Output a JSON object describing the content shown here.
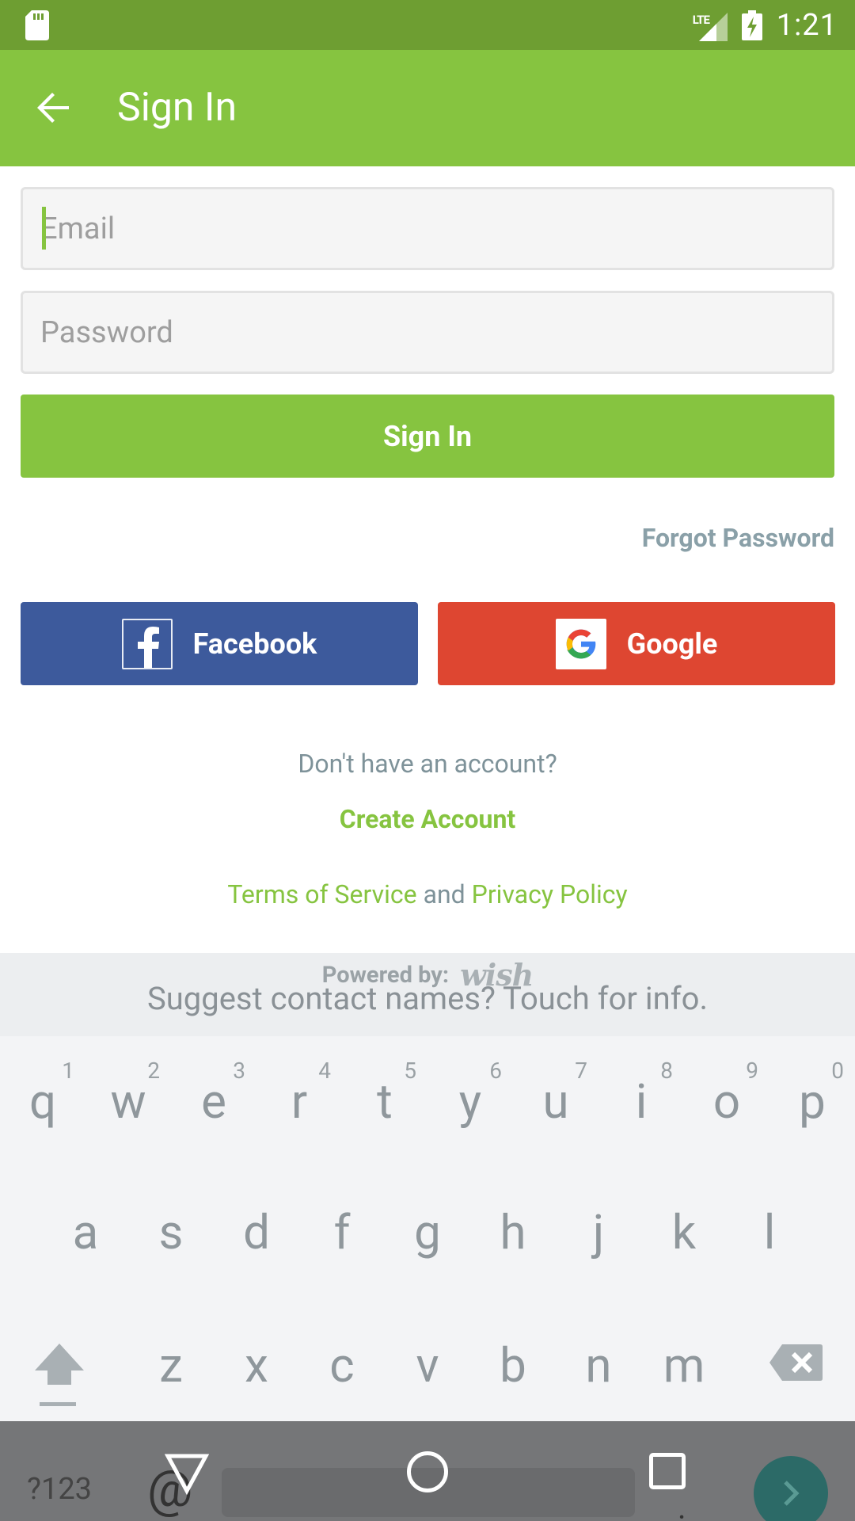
{
  "status_bar": {
    "network": "LTE",
    "time": "1:21"
  },
  "app_bar": {
    "title": "Sign In"
  },
  "form": {
    "email_placeholder": "Email",
    "password_placeholder": "Password",
    "sign_in_label": "Sign In",
    "forgot_password": "Forgot Password"
  },
  "social": {
    "facebook_label": "Facebook",
    "google_label": "Google"
  },
  "footer": {
    "no_account": "Don't have an account?",
    "create_account": "Create Account",
    "terms": "Terms of Service",
    "and": "and",
    "privacy": "Privacy Policy",
    "powered_by": "Powered by:",
    "brand": "wish"
  },
  "keyboard": {
    "suggestion": "Suggest contact names? Touch for info.",
    "row1": [
      {
        "letter": "q",
        "num": "1"
      },
      {
        "letter": "w",
        "num": "2"
      },
      {
        "letter": "e",
        "num": "3"
      },
      {
        "letter": "r",
        "num": "4"
      },
      {
        "letter": "t",
        "num": "5"
      },
      {
        "letter": "y",
        "num": "6"
      },
      {
        "letter": "u",
        "num": "7"
      },
      {
        "letter": "i",
        "num": "8"
      },
      {
        "letter": "o",
        "num": "9"
      },
      {
        "letter": "p",
        "num": "0"
      }
    ],
    "row2": [
      "a",
      "s",
      "d",
      "f",
      "g",
      "h",
      "j",
      "k",
      "l"
    ],
    "row3": [
      "z",
      "x",
      "c",
      "v",
      "b",
      "n",
      "m"
    ],
    "symbols_key": "?123",
    "at_key": "@",
    "period_key": "."
  },
  "colors": {
    "status_bar": "#6e9e32",
    "primary_green": "#86c440",
    "facebook_blue": "#3d5a9c",
    "google_red": "#de4631"
  }
}
